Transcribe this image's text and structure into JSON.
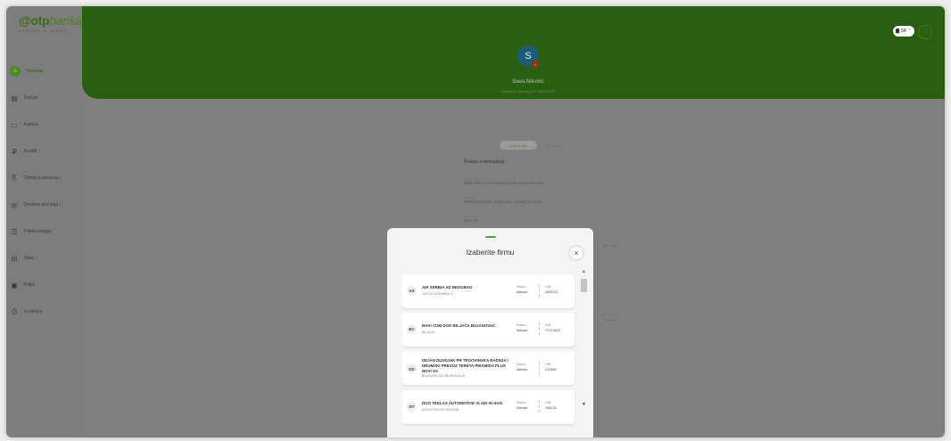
{
  "logo": {
    "brand_mark": "@",
    "brand_bold": "otp",
    "brand_soft": "banka",
    "tagline": "BIZNIS E-BANK"
  },
  "sidebar": {
    "items": [
      {
        "icon": "home-icon",
        "glyph": "⌂",
        "label": "Početna",
        "active": true
      },
      {
        "icon": "accounts-icon",
        "glyph": "▤",
        "label": "Računi"
      },
      {
        "icon": "cards-icon",
        "glyph": "▭",
        "label": "Kartice"
      },
      {
        "icon": "credits-icon",
        "glyph": "₽",
        "label": "Krediti"
      },
      {
        "icon": "domestic-payments-icon",
        "glyph": "⎘",
        "label": "Domaća plaćanja ›"
      },
      {
        "icon": "foreign-payments-icon",
        "glyph": "◎",
        "label": "Devizna plaćanja ›"
      },
      {
        "icon": "order-package-icon",
        "glyph": "☰",
        "label": "Paket naloga ›"
      },
      {
        "icon": "salary-icon",
        "glyph": "⊟",
        "label": "Plate ›"
      },
      {
        "icon": "products-icon",
        "glyph": "▣",
        "label": "Prilivi"
      },
      {
        "icon": "e-invoice-icon",
        "glyph": "⎙",
        "label": "e-menice"
      }
    ]
  },
  "header": {
    "lang_label": "▇ SR ⌃",
    "user_initial": "S",
    "user_name": "Sava Nikolić",
    "user_role": "Zastupnik pravnog lica MANAGER",
    "avatar_badge": "N"
  },
  "tabs": {
    "active": "Moji podaci",
    "other": "Postavke"
  },
  "info": {
    "heading": "Podaci o kompaniji",
    "company_label": "Naziv kompanije",
    "company_value": "DOO TEKLAS AUTOMOTIVE VLADI IN HAN",
    "address_label": "Adresa",
    "address_value": "INDUSTRIJSKA ZONA BB, VLADIČIN HAN",
    "pib_label": "PIB",
    "pib_value": "101 175"
  },
  "modal": {
    "title": "Izaberite firmu",
    "close_glyph": "×",
    "status_label": "Status:",
    "oib_label": "OIB:",
    "firms": [
      {
        "initials": "AS",
        "name": "AIR SERBIA AD BEOGRAD",
        "address": "JURIJA GAGARINA 12",
        "status": "Aktivan",
        "oib": "2006137"
      },
      {
        "initials": "BC",
        "name": "BAKI COM DOO BILJAČA BUJANOVAC",
        "address": "BILJAČA",
        "status": "Aktivan",
        "oib": "17171603"
      },
      {
        "initials": "DD",
        "name": "DEJAN DUVNJAK PR TRGOVINSKA RADNJA I DRUMSKI PREVOZ TERETA PIRAMIDA PLUS NOVI SA",
        "address": "BULEVAR OSLOBOĐENJA 48",
        "status": "Aktivan",
        "oib": "212869"
      },
      {
        "initials": "DT",
        "name": "DOO TEKLAS AUTOMOTIVE VLADI IN HAN",
        "address": "INDUSTRIJSKA ZONA BB",
        "status": "Aktivan",
        "oib": "108175"
      }
    ]
  },
  "scroll": {
    "up": "▲",
    "down": "▼"
  }
}
